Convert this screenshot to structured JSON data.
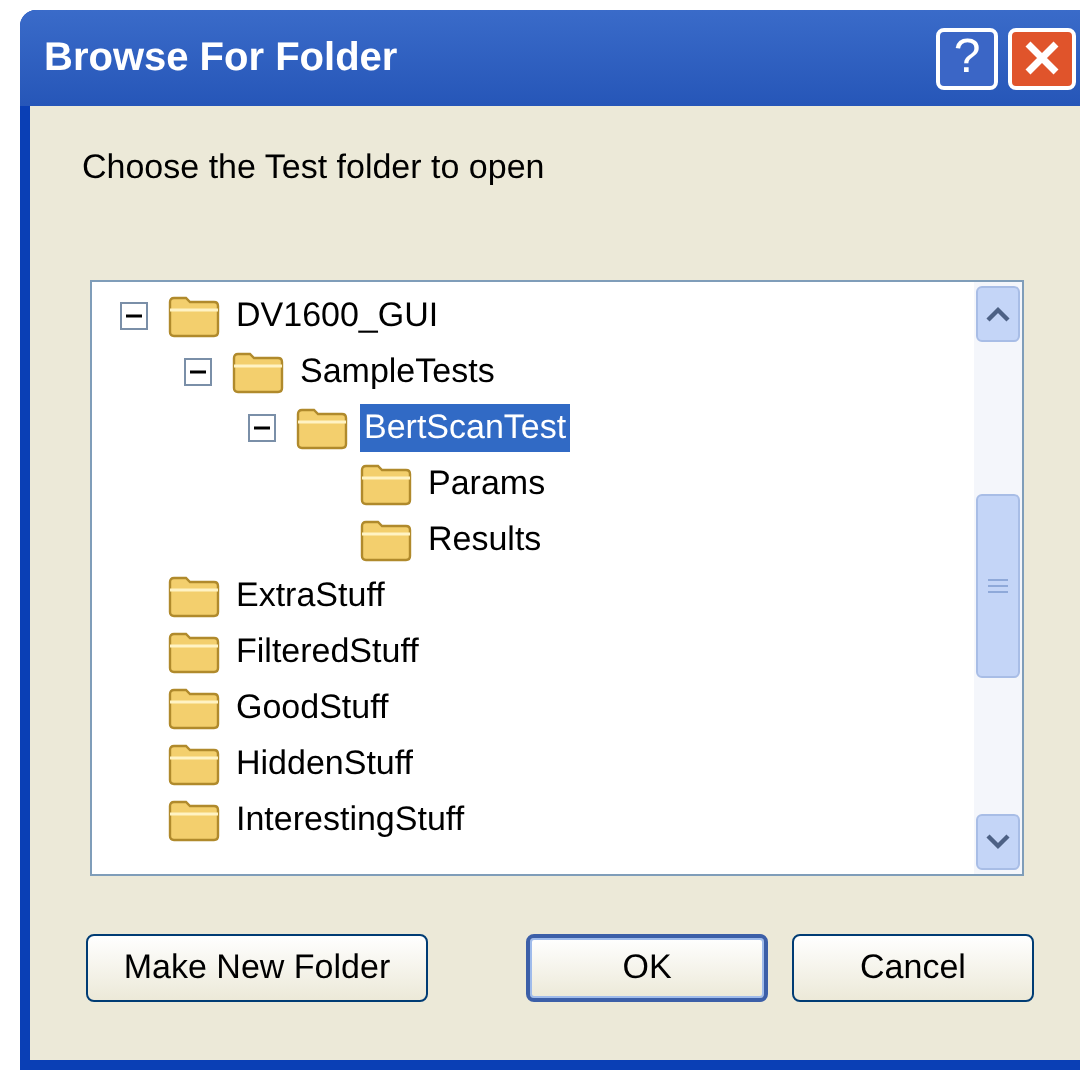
{
  "window": {
    "title": "Browse For Folder",
    "help_button": "?"
  },
  "prompt": "Choose the Test folder to open",
  "tree": [
    {
      "label": "DV1600_GUI",
      "selected": false,
      "expanded": true,
      "children": [
        {
          "label": "SampleTests",
          "selected": false,
          "expanded": true,
          "children": [
            {
              "label": "BertScanTest",
              "selected": true,
              "expanded": true,
              "children": [
                {
                  "label": "Params",
                  "selected": false
                },
                {
                  "label": "Results",
                  "selected": false
                }
              ]
            }
          ]
        }
      ]
    },
    {
      "label": "ExtraStuff",
      "selected": false
    },
    {
      "label": "FilteredStuff",
      "selected": false
    },
    {
      "label": "GoodStuff",
      "selected": false
    },
    {
      "label": "HiddenStuff",
      "selected": false
    },
    {
      "label": "InterestingStuff",
      "selected": false
    }
  ],
  "buttons": [
    {
      "label": "Make New Folder",
      "default": false
    },
    {
      "label": "OK",
      "default": true
    },
    {
      "label": "Cancel",
      "default": false
    }
  ]
}
